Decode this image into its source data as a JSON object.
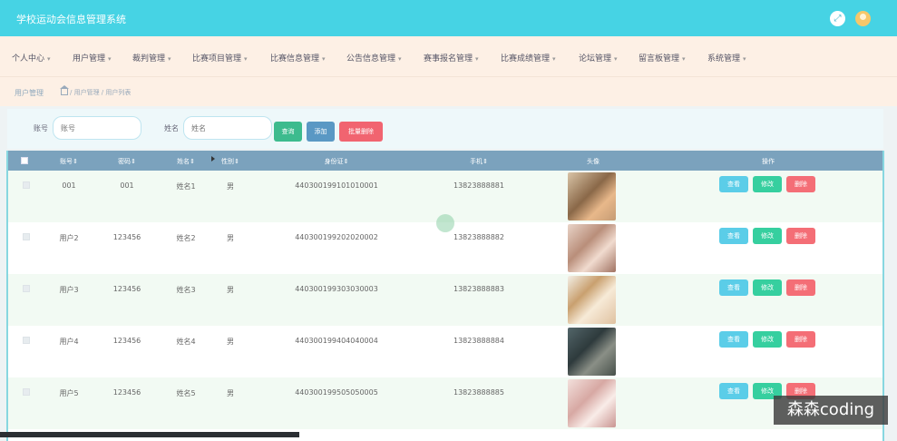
{
  "app": {
    "title": "学校运动会信息管理系统"
  },
  "nav": {
    "items": [
      "个人中心",
      "用户管理",
      "裁判管理",
      "比赛项目管理",
      "比赛信息管理",
      "公告信息管理",
      "赛事报名管理",
      "比赛成绩管理",
      "论坛管理",
      "留言板管理",
      "系统管理"
    ]
  },
  "breadcrumb": {
    "section": "用户管理",
    "path": "/ 用户管理 / 用户列表"
  },
  "search": {
    "account_label": "账号",
    "account_placeholder": "账号",
    "name_label": "姓名",
    "name_placeholder": "姓名",
    "search_button": "查询",
    "add_button": "添加",
    "batch_delete_button": "批量删除"
  },
  "table": {
    "headers": [
      "账号",
      "密码",
      "姓名",
      "性别",
      "身份证",
      "手机",
      "头像",
      "操作"
    ],
    "rows": [
      {
        "account": "001",
        "password": "001",
        "name": "姓名1",
        "gender": "男",
        "id_card": "440300199101010001",
        "phone": "13823888881"
      },
      {
        "account": "用户2",
        "password": "123456",
        "name": "姓名2",
        "gender": "男",
        "id_card": "440300199202020002",
        "phone": "13823888882"
      },
      {
        "account": "用户3",
        "password": "123456",
        "name": "姓名3",
        "gender": "男",
        "id_card": "440300199303030003",
        "phone": "13823888883"
      },
      {
        "account": "用户4",
        "password": "123456",
        "name": "姓名4",
        "gender": "男",
        "id_card": "440300199404040004",
        "phone": "13823888884"
      },
      {
        "account": "用户5",
        "password": "123456",
        "name": "姓名5",
        "gender": "男",
        "id_card": "440300199505050005",
        "phone": "13823888885"
      }
    ],
    "actions": {
      "view": "查看",
      "edit": "修改",
      "delete": "删除"
    }
  },
  "icons": [
    "fullscreen-icon",
    "avatar-icon",
    "home-icon",
    "chevron-down-icon"
  ],
  "colors": {
    "topbar": "#46d3e4",
    "nav": "#fdf0e5",
    "table_header": "#7ba2bd",
    "view": "#5bcde8",
    "edit": "#36cf9f",
    "delete": "#f46e76"
  },
  "watermark": "森森coding"
}
